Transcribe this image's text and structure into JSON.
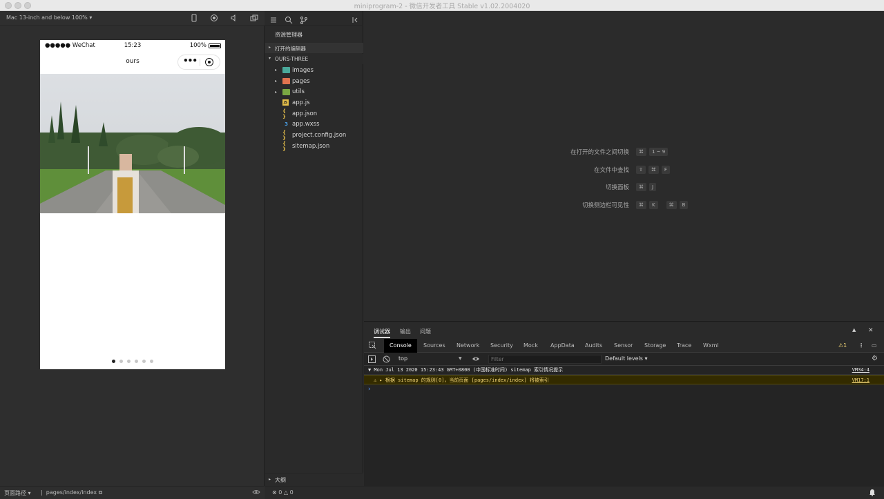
{
  "window": {
    "title": "miniprogram-2 - 微信开发者工具 Stable v1.02.2004020"
  },
  "simulator": {
    "device": "Mac 13-inch and below 100%",
    "device_caret": "▾",
    "status_left": "●●●●● WeChat",
    "status_time": "15:23",
    "status_battery": "100%",
    "nav_title": "ours",
    "capsule_dots": "•••",
    "swiper_count": 6,
    "swiper_active": 1,
    "footer_label": "页面路径",
    "footer_caret": "▾",
    "footer_sep": "|",
    "footer_path": "pages/index/index"
  },
  "explorer": {
    "heading": "资源管理器",
    "open_editors": "打开的编辑器",
    "project": "OURS-THREE",
    "items": [
      {
        "label": "images",
        "icon": "folder-images-icon",
        "color": "#4aa99a",
        "folder": true
      },
      {
        "label": "pages",
        "icon": "folder-pages-icon",
        "color": "#e0734f",
        "folder": true
      },
      {
        "label": "utils",
        "icon": "folder-utils-icon",
        "color": "#7aa843",
        "folder": true
      },
      {
        "label": "app.js",
        "icon": "js-file-icon",
        "color": "#e6c04a",
        "glyph": "JS"
      },
      {
        "label": "app.json",
        "icon": "json-file-icon",
        "color": "#e6c04a",
        "glyph": "{ }"
      },
      {
        "label": "app.wxss",
        "icon": "wxss-file-icon",
        "color": "#4a9fe6",
        "glyph": "3"
      },
      {
        "label": "project.config.json",
        "icon": "json-file-icon",
        "color": "#e6c04a",
        "glyph": "{ }"
      },
      {
        "label": "sitemap.json",
        "icon": "json-file-icon",
        "color": "#e6c04a",
        "glyph": "{ }"
      }
    ],
    "outline": "大纲"
  },
  "editor": {
    "shortcuts": [
      {
        "label": "在打开的文件之间切换",
        "keys": [
          "⌘",
          "1 ~ 9"
        ]
      },
      {
        "label": "在文件中查找",
        "keys": [
          "⇧",
          "⌘",
          "F"
        ]
      },
      {
        "label": "切换面板",
        "keys": [
          "⌘",
          "J"
        ]
      },
      {
        "label": "切换侧边栏可见性",
        "keys": [
          "⌘",
          "K",
          "⌘",
          "B"
        ]
      }
    ]
  },
  "debug": {
    "tabs": [
      "调试器",
      "输出",
      "问题"
    ],
    "devtools_tabs": [
      "Console",
      "Sources",
      "Network",
      "Security",
      "Mock",
      "AppData",
      "Audits",
      "Sensor",
      "Storage",
      "Trace",
      "Wxml"
    ],
    "warning_count": "1",
    "context": "top",
    "filter_placeholder": "Filter",
    "levels": "Default levels ▾",
    "logs": [
      {
        "text": "▼ Mon Jul 13 2020 15:23:43 GMT+0800 (中国标准时间) sitemap 索引情况提示",
        "source": "VM34:4"
      },
      {
        "text": "⚠ ▸ 根据 sitemap 的规则[0]，当前页面 [pages/index/index] 将被索引",
        "source": "VM17:1"
      }
    ],
    "prompt": "›"
  },
  "status": {
    "errors": "0",
    "warnings": "0"
  },
  "colors": {
    "accent": "#5b9bff",
    "warning": "#f3d676"
  }
}
